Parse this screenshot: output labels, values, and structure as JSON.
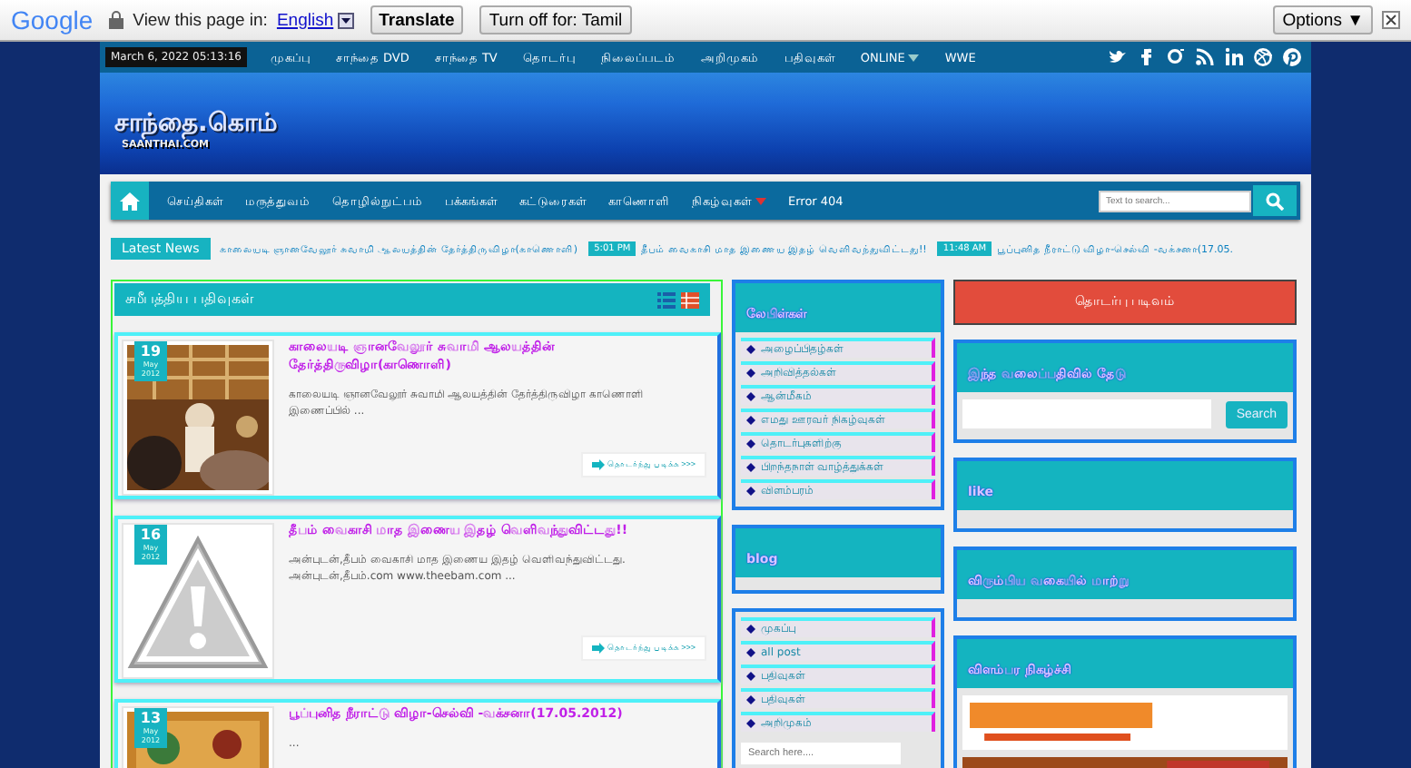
{
  "translate_bar": {
    "logo": "Google",
    "prompt": "View this page in:",
    "language": "English",
    "buttons": [
      "Translate",
      "Turn off for: Tamil"
    ],
    "options": "Options ▼"
  },
  "top_bar": {
    "datetime": "March 6, 2022 05:13:16",
    "links": [
      {
        "label": "முகப்பு",
        "dropdown": false
      },
      {
        "label": "சாந்தை DVD",
        "dropdown": false
      },
      {
        "label": "சாந்தை TV",
        "dropdown": false
      },
      {
        "label": "தொடர்பு",
        "dropdown": false
      },
      {
        "label": "நிலைப்படம்",
        "dropdown": false
      },
      {
        "label": "அறிமுகம்",
        "dropdown": false
      },
      {
        "label": "பதிவுகள்",
        "dropdown": false
      },
      {
        "label": "ONLINE",
        "dropdown": true
      },
      {
        "label": "WWE",
        "dropdown": false
      }
    ]
  },
  "header": {
    "title": "சாந்தை.கொம்",
    "subtitle": "SAANTHAI.COM"
  },
  "main_nav": {
    "items": [
      {
        "label": "செய்திகள்",
        "dropdown": false
      },
      {
        "label": "மருத்துவம்",
        "dropdown": false
      },
      {
        "label": "தொழில்நுட்பம்",
        "dropdown": false
      },
      {
        "label": "பக்கங்கள்",
        "dropdown": false
      },
      {
        "label": "கட்டுரைகள்",
        "dropdown": false
      },
      {
        "label": "காணொளி",
        "dropdown": false
      },
      {
        "label": "நிகழ்வுகள்",
        "dropdown": true
      },
      {
        "label": "Error 404",
        "dropdown": false
      }
    ],
    "search_placeholder": "Text to search..."
  },
  "ticker": {
    "label": "Latest News",
    "items": [
      {
        "text": "காலையடி ஞானவேலூர் சுவாமி ஆலயத்தின் தேர்த்திருவிழா(காணொளி)"
      },
      {
        "time": "5:01 PM",
        "text": "தீபம் வைகாசி மாத இணைய இதழ் வெளிவந்துவிட்டது!!"
      },
      {
        "time": "11:48 AM",
        "text": "பூப்புனித நீராட்டு விழா-செல்வி -வக்சனா(17.05."
      }
    ]
  },
  "recent": {
    "title": "சமீபத்திய பதிவுகள்",
    "posts": [
      {
        "day": "19",
        "month": "May",
        "year": "2012",
        "title": "காலையடி ஞானவேலூர் சுவாமி ஆலயத்தின் தேர்த்திருவிழா(காணொளி)",
        "excerpt": "காலையடி ஞானவேலூர் சுவாமி ஆலயத்தின் தேர்த்திருவிழா காணொளி இணைப்பில் ...",
        "more": "தொடர்ந்து படிக்க >>>"
      },
      {
        "day": "16",
        "month": "May",
        "year": "2012",
        "kind": "placeholder",
        "title": "தீபம் வைகாசி மாத இணைய இதழ் வெளிவந்துவிட்டது!!",
        "excerpt": "அன்புடன்,தீபம் வைகாசி மாத இணைய இதழ் வெளிவந்துவிட்டது. அன்புடன்,தீபம்.com www.theebam.com ...",
        "more": "தொடர்ந்து படிக்க >>>"
      },
      {
        "day": "13",
        "month": "May",
        "year": "2012",
        "title": "பூப்புனித நீராட்டு விழா-செல்வி -வக்சனா(17.05.2012)",
        "excerpt": "..."
      }
    ]
  },
  "middle": [
    {
      "title": "லேபிள்கள்",
      "items": [
        "அழைப்பிதழ்கள்",
        "அறிவித்தல்கள்",
        "ஆன்மீகம்",
        "எமது ஊரவர் நிகழ்வுகள்",
        "தொடர்புகளிற்கு",
        "பிறந்தநாள் வாழ்த்துக்கள்",
        "விளம்பரம்"
      ]
    },
    {
      "title": "blog"
    },
    {
      "items": [
        "முகப்பு",
        "all post",
        "பதிவுகள்",
        "பதிவுகள்",
        "அறிமுகம்"
      ],
      "search_placeholder": "Search here...."
    }
  ],
  "right": {
    "contact": "தொடர்பு படிவம்",
    "widgets": [
      {
        "kind": "search",
        "title": "இந்த வலைப்பதிவில் தேடு",
        "button": "Search"
      },
      {
        "kind": "empty",
        "title": "like"
      },
      {
        "kind": "empty",
        "title": "விரும்பிய வகையில் மாற்று"
      },
      {
        "kind": "ads",
        "title": "விளம்பர நிகழ்ச்சி"
      }
    ]
  }
}
